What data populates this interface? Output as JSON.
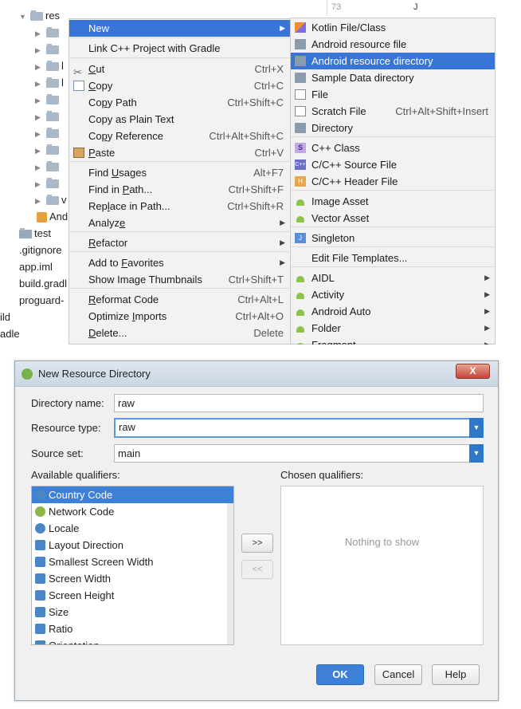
{
  "tree": {
    "root_label": "res",
    "gutter_line_number": "73",
    "gutter_text": "J",
    "items": [
      {
        "label": "",
        "kind": "folder"
      },
      {
        "label": "",
        "kind": "folder"
      },
      {
        "label": "l",
        "kind": "folder"
      },
      {
        "label": "l",
        "kind": "folder"
      },
      {
        "label": "",
        "kind": "folder"
      },
      {
        "label": "",
        "kind": "folder"
      },
      {
        "label": "",
        "kind": "folder"
      },
      {
        "label": "",
        "kind": "folder"
      },
      {
        "label": "",
        "kind": "folder"
      },
      {
        "label": "",
        "kind": "folder"
      },
      {
        "label": "v",
        "kind": "folder"
      },
      {
        "label": "And",
        "kind": "manifest"
      }
    ],
    "lower_items": [
      "test",
      ".gitignore",
      "app.iml",
      "build.gradl",
      "proguard-",
      "ild",
      "adle"
    ]
  },
  "context_menu": {
    "items": [
      {
        "label": "New",
        "shortcut": "",
        "submenu": true,
        "selected": true
      },
      {
        "label": "Link C++ Project with Gradle",
        "shortcut": ""
      },
      {
        "label": "Cut",
        "shortcut": "Ctrl+X",
        "icon": "cut-icon"
      },
      {
        "label": "Copy",
        "shortcut": "Ctrl+C",
        "icon": "copy-icon"
      },
      {
        "label": "Copy Path",
        "shortcut": "Ctrl+Shift+C"
      },
      {
        "label": "Copy as Plain Text",
        "shortcut": ""
      },
      {
        "label": "Copy Reference",
        "shortcut": "Ctrl+Alt+Shift+C"
      },
      {
        "label": "Paste",
        "shortcut": "Ctrl+V",
        "icon": "paste-icon"
      },
      {
        "label": "Find Usages",
        "shortcut": "Alt+F7"
      },
      {
        "label": "Find in Path...",
        "shortcut": "Ctrl+Shift+F"
      },
      {
        "label": "Replace in Path...",
        "shortcut": "Ctrl+Shift+R"
      },
      {
        "label": "Analyze",
        "shortcut": "",
        "submenu": true
      },
      {
        "label": "Refactor",
        "shortcut": "",
        "submenu": true
      },
      {
        "label": "Add to Favorites",
        "shortcut": "",
        "submenu": true
      },
      {
        "label": "Show Image Thumbnails",
        "shortcut": "Ctrl+Shift+T"
      },
      {
        "label": "Reformat Code",
        "shortcut": "Ctrl+Alt+L"
      },
      {
        "label": "Optimize Imports",
        "shortcut": "Ctrl+Alt+O"
      },
      {
        "label": "Delete...",
        "shortcut": "Delete"
      }
    ]
  },
  "new_submenu": {
    "items": [
      {
        "label": "Kotlin File/Class",
        "shortcut": "",
        "icon": "kotlin-icon"
      },
      {
        "label": "Android resource file",
        "shortcut": "",
        "icon": "resource-file-icon"
      },
      {
        "label": "Android resource directory",
        "shortcut": "",
        "icon": "folder-icon",
        "selected": true
      },
      {
        "label": "Sample Data directory",
        "shortcut": "",
        "icon": "folder-icon"
      },
      {
        "label": "File",
        "shortcut": "",
        "icon": "file-icon"
      },
      {
        "label": "Scratch File",
        "shortcut": "Ctrl+Alt+Shift+Insert",
        "icon": "scratch-file-icon"
      },
      {
        "label": "Directory",
        "shortcut": "",
        "icon": "folder-icon"
      },
      {
        "label": "C++ Class",
        "shortcut": "",
        "icon": "cpp-class-icon"
      },
      {
        "label": "C/C++ Source File",
        "shortcut": "",
        "icon": "cpp-source-icon"
      },
      {
        "label": "C/C++ Header File",
        "shortcut": "",
        "icon": "cpp-header-icon"
      },
      {
        "label": "Image Asset",
        "shortcut": "",
        "icon": "android-icon"
      },
      {
        "label": "Vector Asset",
        "shortcut": "",
        "icon": "android-icon"
      },
      {
        "label": "Singleton",
        "shortcut": "",
        "icon": "java-icon"
      },
      {
        "label": "Edit File Templates...",
        "shortcut": ""
      },
      {
        "label": "AIDL",
        "shortcut": "",
        "icon": "android-icon",
        "submenu": true
      },
      {
        "label": "Activity",
        "shortcut": "",
        "icon": "android-icon",
        "submenu": true
      },
      {
        "label": "Android Auto",
        "shortcut": "",
        "icon": "android-icon",
        "submenu": true
      },
      {
        "label": "Folder",
        "shortcut": "",
        "icon": "android-icon",
        "submenu": true
      },
      {
        "label": "Fragment",
        "shortcut": "",
        "icon": "android-icon",
        "submenu": true
      }
    ]
  },
  "dialog": {
    "title": "New Resource Directory",
    "close_label": "X",
    "directory_name_label": "Directory name:",
    "directory_name_value": "raw",
    "resource_type_label": "Resource type:",
    "resource_type_value": "raw",
    "source_set_label": "Source set:",
    "source_set_value": "main",
    "available_label": "Available qualifiers:",
    "chosen_label": "Chosen qualifiers:",
    "qualifiers": [
      "Country Code",
      "Network Code",
      "Locale",
      "Layout Direction",
      "Smallest Screen Width",
      "Screen Width",
      "Screen Height",
      "Size",
      "Ratio",
      "Orientation"
    ],
    "add_button": ">>",
    "remove_button": "<<",
    "empty_text": "Nothing to show",
    "ok_label": "OK",
    "cancel_label": "Cancel",
    "help_label": "Help"
  },
  "colors": {
    "selection": "#3875d7",
    "dialog_bg": "#f0f0f0",
    "menu_bg": "#f2f2f2"
  }
}
